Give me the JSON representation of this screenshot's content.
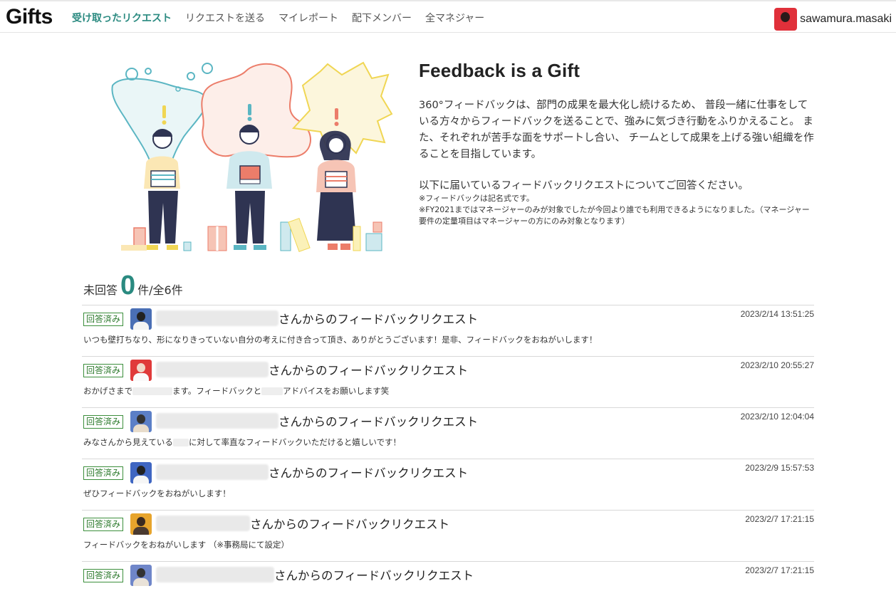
{
  "header": {
    "logo": "Gifts",
    "nav": [
      {
        "label": "受け取ったリクエスト",
        "active": true
      },
      {
        "label": "リクエストを送る",
        "active": false
      },
      {
        "label": "マイレポート",
        "active": false
      },
      {
        "label": "配下メンバー",
        "active": false
      },
      {
        "label": "全マネジャー",
        "active": false
      }
    ],
    "user_name": "sawamura.masaki"
  },
  "intro": {
    "title": "Feedback is a Gift",
    "body": "360°フィードバックは、部門の成果を最大化し続けるため、 普段一緒に仕事をしている方々からフィードバックを送ることで、強みに気づき行動をふりかえること。 また、それぞれが苦手な面をサポートし合い、 チームとして成果を上げる強い組織を作ることを目指しています。",
    "ask": "以下に届いているフィードバックリクエストについてご回答ください。",
    "note1": "※フィードバックは記名式です。",
    "note2": "※FY2021まではマネージャーのみが対象でしたが今回より誰でも利用できるようになりました。（マネージャー要件の定量項目はマネージャーの方にのみ対象となります）"
  },
  "summary": {
    "prefix": "未回答",
    "unanswered": "0",
    "suffix": "件/全6件"
  },
  "requests": [
    {
      "status": "回答済み",
      "title": "さんからのフィードバックリクエスト",
      "date": "2023/2/14 13:51:25",
      "message_parts": [
        "いつも壁打ちなり、形になりきっていない自分の考えに付き合って頂き、ありがとうございます！是非、フィードバックをおねがいします！"
      ],
      "avatar_bg": "#4a6fb5",
      "avatar_head": "#222",
      "avatar_body": "#f4f4f4"
    },
    {
      "status": "回答済み",
      "title": "さんからのフィードバックリクエスト",
      "date": "2023/2/10 20:55:27",
      "message_parts": [
        "おかげさまで",
        "ます。フィードバックと",
        "アドバイスをお願いします笑"
      ],
      "avatar_bg": "#e03a3a",
      "avatar_head": "#f1d7c8",
      "avatar_body": "#fafafa"
    },
    {
      "status": "回答済み",
      "title": "さんからのフィードバックリクエスト",
      "date": "2023/2/10 12:04:04",
      "message_parts": [
        "みなさんから見えている",
        "に対して率直なフィードバックいただけると嬉しいです！"
      ],
      "avatar_bg": "#5b7fc7",
      "avatar_head": "#333",
      "avatar_body": "#e8dccb"
    },
    {
      "status": "回答済み",
      "title": "さんからのフィードバックリクエスト",
      "date": "2023/2/9 15:57:53",
      "message_parts": [
        "ぜひフィードバックをおねがいします！"
      ],
      "avatar_bg": "#3f66c2",
      "avatar_head": "#222",
      "avatar_body": "#f6f6f6"
    },
    {
      "status": "回答済み",
      "title": "さんからのフィードバックリクエスト",
      "date": "2023/2/7 17:21:15",
      "message_parts": [
        "フィードバックをおねがいします （※事務局にて設定）"
      ],
      "avatar_bg": "#e7a42c",
      "avatar_head": "#3a2a20",
      "avatar_body": "#4a3a30"
    },
    {
      "status": "回答済み",
      "title": "さんからのフィードバックリクエスト",
      "date": "2023/2/7 17:21:15",
      "message_parts": [],
      "avatar_bg": "#6f86c9",
      "avatar_head": "#333",
      "avatar_body": "#e9e2d8"
    }
  ]
}
